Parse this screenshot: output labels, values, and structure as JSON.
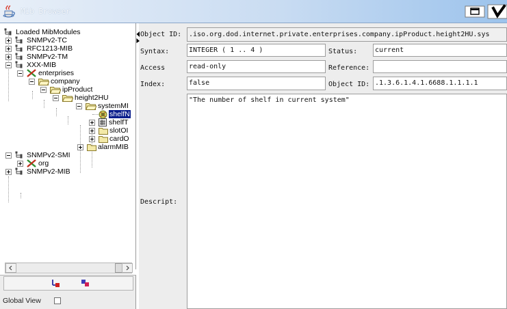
{
  "window": {
    "title": "Mib Browser",
    "restore_icon": "restore-window-icon",
    "close_icon": "close-icon"
  },
  "tree": {
    "root_label": "Loaded MibModules",
    "nodes": [
      {
        "label": "Loaded MibModules",
        "icon": "module-group-icon"
      },
      {
        "label": "SNMPv2-TC",
        "icon": "mib-module-icon"
      },
      {
        "label": "RFC1213-MIB",
        "icon": "mib-module-icon"
      },
      {
        "label": "SNMPv2-TM",
        "icon": "mib-module-icon"
      },
      {
        "label": "XXX-MIB",
        "icon": "mib-module-icon"
      },
      {
        "label": "enterprises",
        "icon": "node-cross-icon"
      },
      {
        "label": "company",
        "icon": "folder-open-icon"
      },
      {
        "label": "ipProduct",
        "icon": "folder-open-icon"
      },
      {
        "label": "height2HU",
        "icon": "folder-open-icon"
      },
      {
        "label": "systemMI",
        "icon": "folder-open-icon"
      },
      {
        "label": "shelfN",
        "icon": "leaf-scalar-icon",
        "selected": true
      },
      {
        "label": "shelfT",
        "icon": "table-icon"
      },
      {
        "label": "slotOI",
        "icon": "folder-icon"
      },
      {
        "label": "cardO",
        "icon": "folder-icon"
      },
      {
        "label": "alarmMIB",
        "icon": "folder-icon"
      },
      {
        "label": "SNMPv2-SMI",
        "icon": "mib-module-icon"
      },
      {
        "label": "org",
        "icon": "node-cross-icon"
      },
      {
        "label": "SNMPv2-MIB",
        "icon": "mib-module-icon"
      }
    ]
  },
  "bottom": {
    "tool1_icon": "tree-expand-icon",
    "tool2_icon": "tree-collapse-icon",
    "global_view_label": "Global View",
    "global_view_checked": false
  },
  "details": {
    "object_id_label": "Object ID:",
    "object_id_value": ".iso.org.dod.internet.private.enterprises.company.ipProduct.height2HU.sys",
    "syntax_label": "Syntax:",
    "syntax_value": "INTEGER  ( 1 .. 4 )",
    "status_label": "Status:",
    "status_value": "current",
    "access_label": "Access",
    "access_value": "read-only",
    "reference_label": "Reference:",
    "reference_value": "",
    "index_label": "Index:",
    "index_value": "false",
    "oid_label": "Object ID:",
    "oid_value": ".1.3.6.1.4.1.6688.1.1.1.1",
    "description_label": "Descript:",
    "description_value": "\"The number of shelf in current system\""
  }
}
